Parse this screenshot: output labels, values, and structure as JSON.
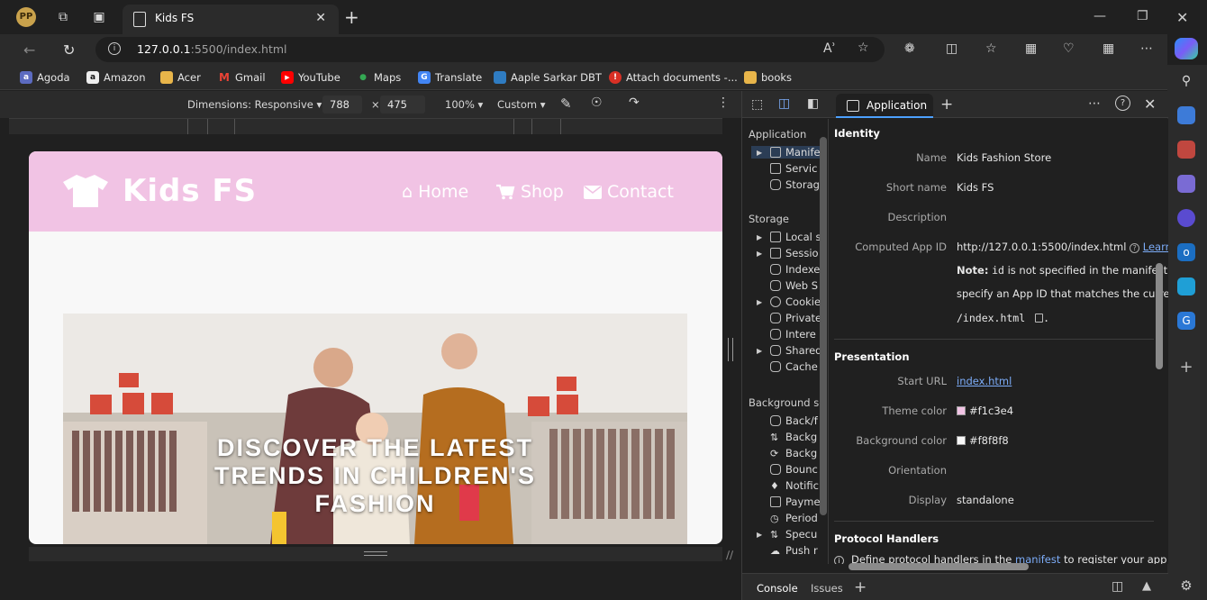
{
  "browser": {
    "tab_title": "Kids FS",
    "url_host": "127.0.0.1",
    "url_rest": ":5500/index.html",
    "read_aloud": "Aʾ",
    "more": "⋯"
  },
  "bookmarks": [
    {
      "label": "Agoda",
      "icon": "agoda-icon",
      "color": "#5c6bc0"
    },
    {
      "label": "Amazon",
      "icon": "amazon-icon",
      "color": "#222"
    },
    {
      "label": "Acer",
      "icon": "folder-icon",
      "color": "#e8b54a"
    },
    {
      "label": "Gmail",
      "icon": "gmail-icon",
      "color": "#ea4335"
    },
    {
      "label": "YouTube",
      "icon": "youtube-icon",
      "color": "#ff0000"
    },
    {
      "label": "Maps",
      "icon": "maps-icon",
      "color": "#34a853"
    },
    {
      "label": "Translate",
      "icon": "translate-icon",
      "color": "#4285f4"
    },
    {
      "label": "Aaple Sarkar DBT",
      "icon": "doc-icon",
      "color": "#2f7cc2"
    },
    {
      "label": "Attach documents -...",
      "icon": "attach-icon",
      "color": "#d93025"
    },
    {
      "label": "books",
      "icon": "folder-icon",
      "color": "#e8b54a"
    }
  ],
  "device_toolbar": {
    "dimensions": "Dimensions: Responsive ▾",
    "width": "788",
    "times": "×",
    "height": "475",
    "zoom": "100% ▾",
    "throttle": "Custom ▾"
  },
  "site": {
    "brand": "Kids FS",
    "nav": [
      {
        "label": "Home",
        "icon": "home-icon"
      },
      {
        "label": "Shop",
        "icon": "cart-icon"
      },
      {
        "label": "Contact",
        "icon": "envelope-icon"
      }
    ],
    "hero_text": "DISCOVER THE LATEST TRENDS IN CHILDREN'S FASHION",
    "colors": {
      "header": "#f1c3e4",
      "background": "#f8f8f8"
    }
  },
  "devtools": {
    "active_tab": "Application",
    "sidebar": {
      "application_header": "Application",
      "application_items": [
        "Manife",
        "Servic",
        "Storag"
      ],
      "storage_header": "Storage",
      "storage_items": [
        "Local s",
        "Sessio",
        "Indexe",
        "Web S",
        "Cookie",
        "Private",
        "Intere",
        "Shared",
        "Cache"
      ],
      "background_header": "Background se",
      "background_items": [
        "Back/f",
        "Backg",
        "Backg",
        "Bounc",
        "Notific",
        "Payme",
        "Period",
        "Specu",
        "Push r"
      ]
    },
    "identity": {
      "header": "Identity",
      "name_label": "Name",
      "name_value": "Kids Fashion Store",
      "short_label": "Short name",
      "short_value": "Kids FS",
      "desc_label": "Description",
      "appid_label": "Computed App ID",
      "appid_value": "http://127.0.0.1:5500/index.html",
      "learn": "Learn",
      "note_bold": "Note:",
      "note_code": "id",
      "note_text": "is not specified in the manifest, s",
      "note_line2": "specify an App ID that matches the current",
      "note_line3": "/index.html"
    },
    "presentation": {
      "header": "Presentation",
      "start_label": "Start URL",
      "start_value": "index.html",
      "theme_label": "Theme color",
      "theme_value": "#f1c3e4",
      "bg_label": "Background color",
      "bg_value": "#f8f8f8",
      "orient_label": "Orientation",
      "display_label": "Display",
      "display_value": "standalone"
    },
    "protocol": {
      "header": "Protocol Handlers",
      "text_a": "Define protocol handlers in the",
      "text_link": "manifest",
      "text_b": "to register your app as"
    },
    "drawer": {
      "console": "Console",
      "issues": "Issues"
    }
  }
}
